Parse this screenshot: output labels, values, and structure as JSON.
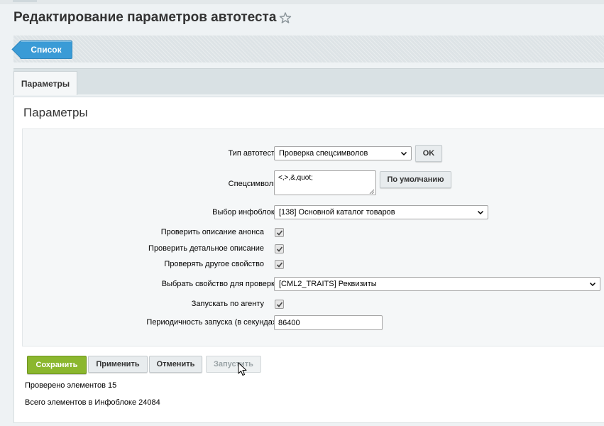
{
  "page": {
    "title": "Редактирование параметров автотеста",
    "favorite_icon": "star-outline-icon"
  },
  "toolbar": {
    "list_label": "Список"
  },
  "tabs": [
    {
      "label": "Параметры",
      "active": true
    }
  ],
  "section": {
    "title": "Параметры"
  },
  "form": {
    "test_type": {
      "label": "Тип автотеста",
      "value": "Проверка спецсимволов",
      "ok_label": "OK"
    },
    "special_chars": {
      "label": "Спецсимволы",
      "value": "<,>,&,quot;",
      "default_label": "По умолчанию"
    },
    "infoblock": {
      "label": "Выбор инфоблока",
      "value": "[138] Основной каталог товаров"
    },
    "check_preview": {
      "label": "Проверить описание анонса",
      "checked": true
    },
    "check_detail": {
      "label": "Проверить детальное описание",
      "checked": true
    },
    "check_other": {
      "label": "Проверять другое свойство",
      "checked": true
    },
    "property": {
      "label": "Выбрать свойство для проверки",
      "value": "[CML2_TRAITS] Реквизиты"
    },
    "run_by_agent": {
      "label": "Запускать по агенту",
      "checked": true
    },
    "period": {
      "label": "Периодичность запуска (в секундах)",
      "value": "86400"
    }
  },
  "actions": {
    "save": "Сохранить",
    "apply": "Применить",
    "cancel": "Отменить",
    "run": "Запустить"
  },
  "stats": {
    "checked": "Проверено элементов 15",
    "total": "Всего элементов в Инфоблоке 24084"
  },
  "colors": {
    "accent_blue": "#3a9bd6",
    "save_green": "#8bb72e"
  }
}
